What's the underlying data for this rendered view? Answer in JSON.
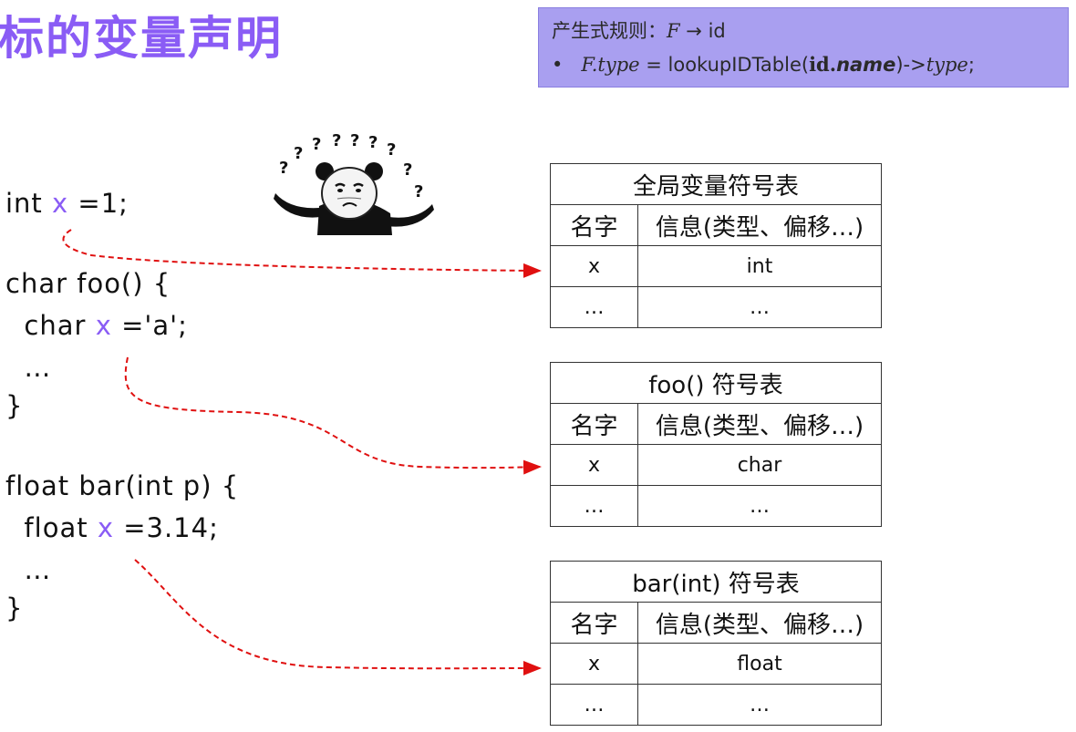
{
  "slide": {
    "title": "标的变量声明"
  },
  "rule": {
    "prefix": "产生式规则：",
    "production_lhs": "F",
    "production_arrow": "→",
    "production_rhs": "id",
    "bullet": "•",
    "attr_lhs": "F.type",
    "equals": " = ",
    "func": "lookupIDTable(",
    "arg_id": "id.",
    "arg_name": "name",
    "func_close": ")->",
    "attr_rhs": "type",
    "semicolon": ";"
  },
  "code": {
    "l1_pre": "int ",
    "l1_var": "x",
    "l1_post": " =1;",
    "l2": "char foo() {",
    "l3_pre": "  char ",
    "l3_var": "x",
    "l3_post": " ='a';",
    "l4": "  …",
    "l5": "}",
    "l6": "float bar(int p) {",
    "l7_pre": "  float ",
    "l7_var": "x",
    "l7_post": " =3.14;",
    "l8": "  …",
    "l9": "}"
  },
  "tables": [
    {
      "title": "全局变量符号表",
      "col1": "名字",
      "col2": "信息(类型、偏移…)",
      "rows": [
        [
          "x",
          "int"
        ],
        [
          "…",
          "…"
        ]
      ]
    },
    {
      "title": "foo() 符号表",
      "col1": "名字",
      "col2": "信息(类型、偏移…)",
      "rows": [
        [
          "x",
          "char"
        ],
        [
          "…",
          "…"
        ]
      ]
    },
    {
      "title": "bar(int) 符号表",
      "col1": "名字",
      "col2": "信息(类型、偏移…)",
      "rows": [
        [
          "x",
          "float"
        ],
        [
          "…",
          "…"
        ]
      ]
    }
  ],
  "meme": {
    "icon": "confused-panda-icon",
    "question_marks": [
      "?",
      "?",
      "?",
      "?",
      "?",
      "?",
      "?",
      "?",
      "?"
    ]
  },
  "colors": {
    "accent": "#8a5cf5",
    "rule_box_bg": "#a99ff0",
    "arrow": "#e01010"
  }
}
